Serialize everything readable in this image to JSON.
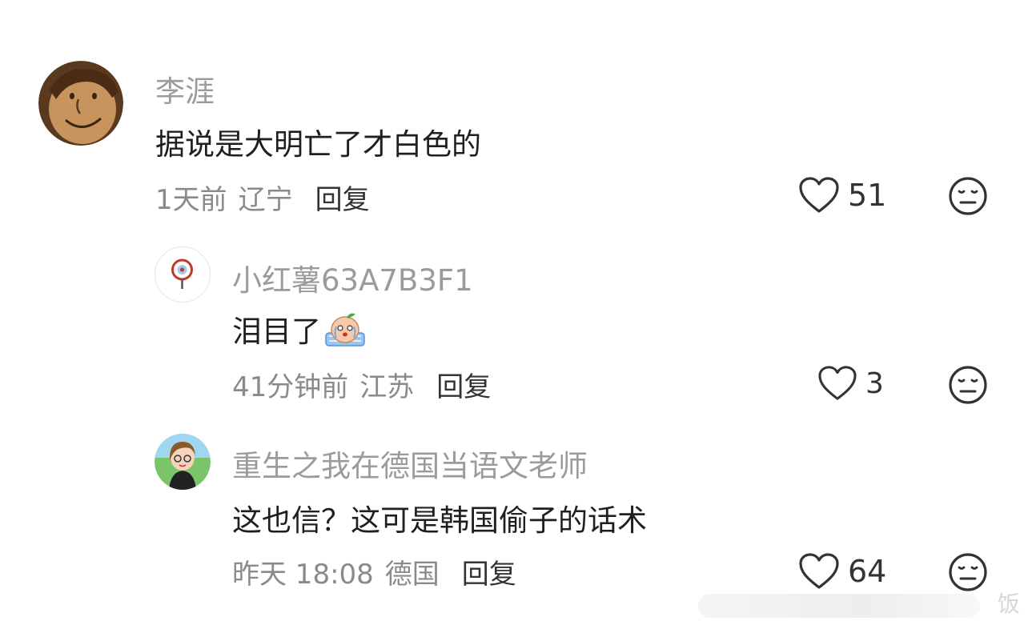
{
  "comments": [
    {
      "username": "李涯",
      "text": "据说是大明亡了才白色的",
      "time": "1天前",
      "location": "辽宁",
      "reply_label": "回复",
      "likes": "51"
    },
    {
      "username": "小红薯63A7B3F1",
      "text": "泪目了",
      "sticker_icon": "crying-peach-sticker",
      "time": "41分钟前",
      "location": "江苏",
      "reply_label": "回复",
      "likes": "3"
    },
    {
      "username": "重生之我在德国当语文老师",
      "text": "这也信？这可是韩国偷子的话术",
      "time": "昨天 18:08",
      "location": "德国",
      "reply_label": "回复",
      "likes": "64"
    }
  ],
  "icons": {
    "like": "heart-outline-icon",
    "dislike": "meh-face-icon"
  },
  "watermark": "饭",
  "colors": {
    "username": "#9b9b9b",
    "content": "#1f1f1f",
    "meta": "#8a8a8a",
    "icon": "#333333"
  }
}
